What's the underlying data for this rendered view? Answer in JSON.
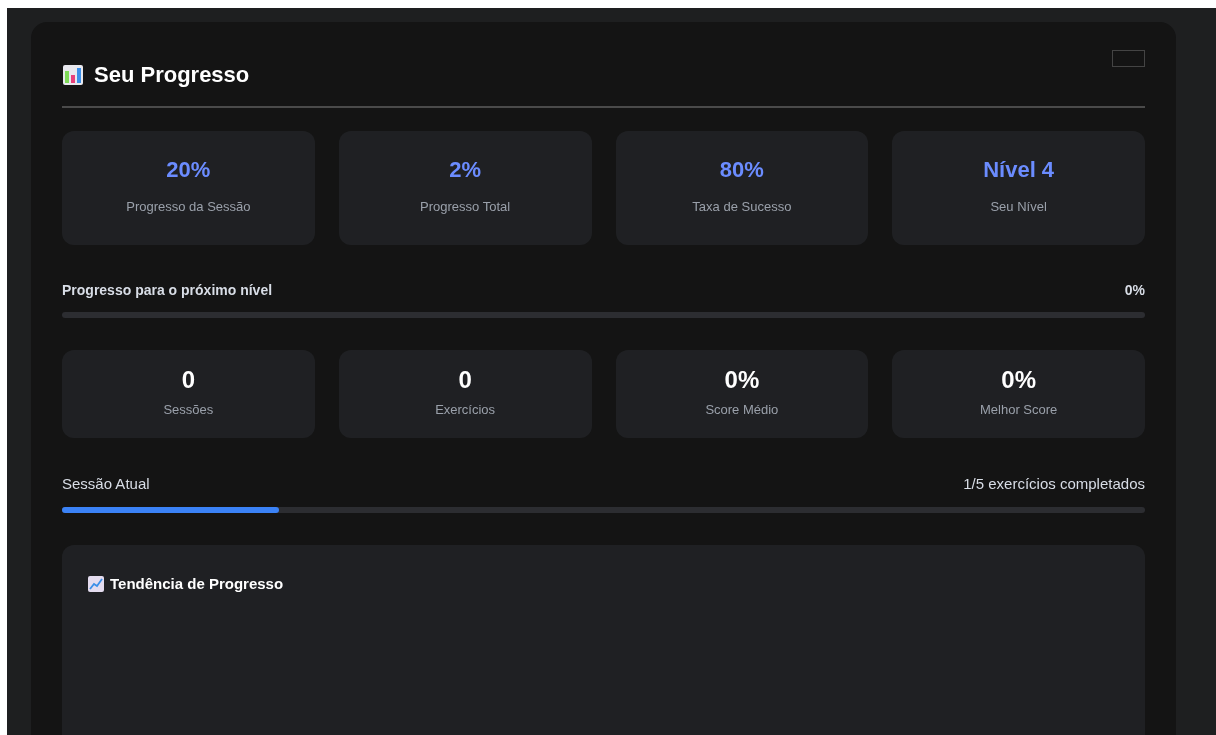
{
  "header": {
    "title": "Seu Progresso"
  },
  "stats": [
    {
      "value": "20%",
      "label": "Progresso da Sessão"
    },
    {
      "value": "2%",
      "label": "Progresso Total"
    },
    {
      "value": "80%",
      "label": "Taxa de Sucesso"
    },
    {
      "value": "Nível 4",
      "label": "Seu Nível"
    }
  ],
  "level_progress": {
    "label": "Progresso para o próximo nível",
    "reading": "0%",
    "level": 0
  },
  "counters": [
    {
      "value": "0",
      "label": "Sessões"
    },
    {
      "value": "0",
      "label": "Exercícios"
    },
    {
      "value": "0%",
      "label": "Score Médio"
    },
    {
      "value": "0%",
      "label": "Melhor Score"
    }
  ],
  "session": {
    "label": "Sessão Atual",
    "reading": "1/5 exercícios completados",
    "level": 0.2
  },
  "trend_panel": {
    "title": "Tendência de Progresso"
  }
}
